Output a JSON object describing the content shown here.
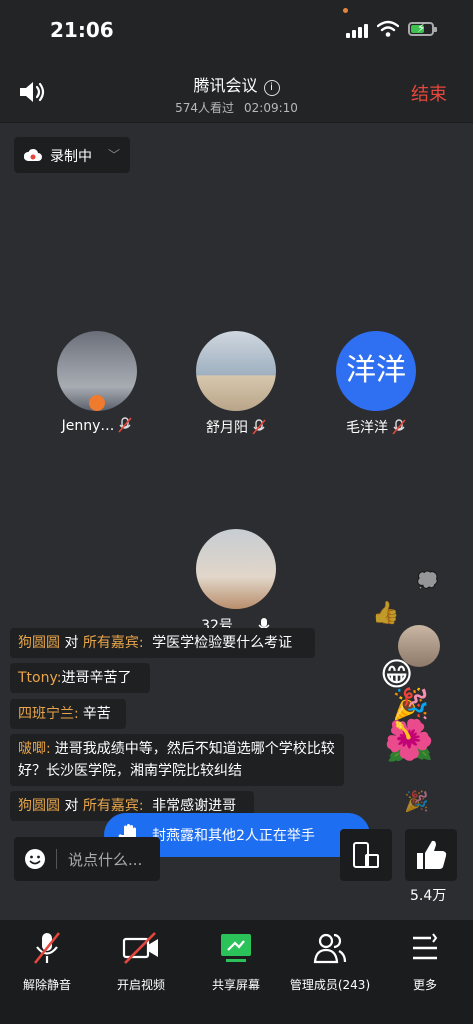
{
  "status_bar": {
    "time": "21:06"
  },
  "header": {
    "title": "腾讯会议",
    "viewers": "574人看过",
    "duration": "02:09:10",
    "end_label": "结束"
  },
  "recording": {
    "label": "录制中"
  },
  "participants": [
    {
      "name": "Jenny…"
    },
    {
      "name": "舒月阳"
    },
    {
      "name": "毛洋洋",
      "avatar_text": "洋洋"
    },
    {
      "name": "32号…"
    }
  ],
  "chat": [
    {
      "sender": "狗圆圆",
      "to_label": "对",
      "recipient": "所有嘉宾:",
      "text": "学医学检验要什么考证"
    },
    {
      "sender": "Ttony:",
      "text": "进哥辛苦了"
    },
    {
      "sender": "四班宁兰:",
      "text": "辛苦"
    },
    {
      "sender": "啵唧:",
      "text": "进哥我成绩中等，然后不知道选哪个学校比较好？长沙医学院，湘南学院比较纠结"
    },
    {
      "sender": "狗圆圆",
      "to_label": "对",
      "recipient": "所有嘉宾:",
      "text": "非常感谢进哥"
    }
  ],
  "raise_hand": {
    "text": "封燕露和其他2人正在举手"
  },
  "chat_input": {
    "placeholder": "说点什么..."
  },
  "likes": {
    "count": "5.4万"
  },
  "toolbar": {
    "unmute": "解除静音",
    "video": "开启视频",
    "share": "共享屏幕",
    "members": "管理成员(243)",
    "more": "更多"
  },
  "colors": {
    "accent_blue": "#1e6ef2",
    "end_red": "#e5473c",
    "share_green": "#2bc25a",
    "name_orange": "#e8a54a"
  },
  "icons": [
    "speaker-icon",
    "info-icon",
    "cloud-icon",
    "chevron-down-icon",
    "mic-muted-icon",
    "mic-icon",
    "raise-hand-icon",
    "chevron-right-icon",
    "smile-icon",
    "phone-rotate-icon",
    "thumbs-up-icon",
    "camera-off-icon",
    "share-screen-icon",
    "members-icon",
    "more-icon"
  ]
}
